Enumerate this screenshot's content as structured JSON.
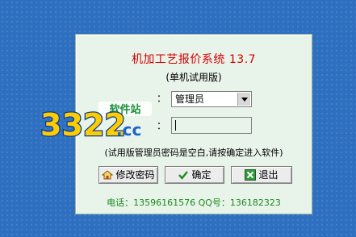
{
  "dialog": {
    "title": "机加工艺报价系统  13.7",
    "subtitle": "(单机试用版)",
    "user_label_suffix": "：",
    "user_value": "管理员",
    "pwd_label_suffix": "：",
    "hint": "(试用版管理员密码是空白,请按确定进入软件)",
    "buttons": {
      "modify": "修改密码",
      "ok": "确定",
      "exit": "退出"
    },
    "contact": "电话：13596161576   QQ号：136182323"
  },
  "watermark": {
    "number": "3322",
    "site": "软件站",
    "domain": ".cc"
  },
  "colors": {
    "title": "#d40000",
    "contact": "#1c8a1c",
    "dialog_bg": "#e8f3ea",
    "desktop": "#2e6fc0"
  }
}
